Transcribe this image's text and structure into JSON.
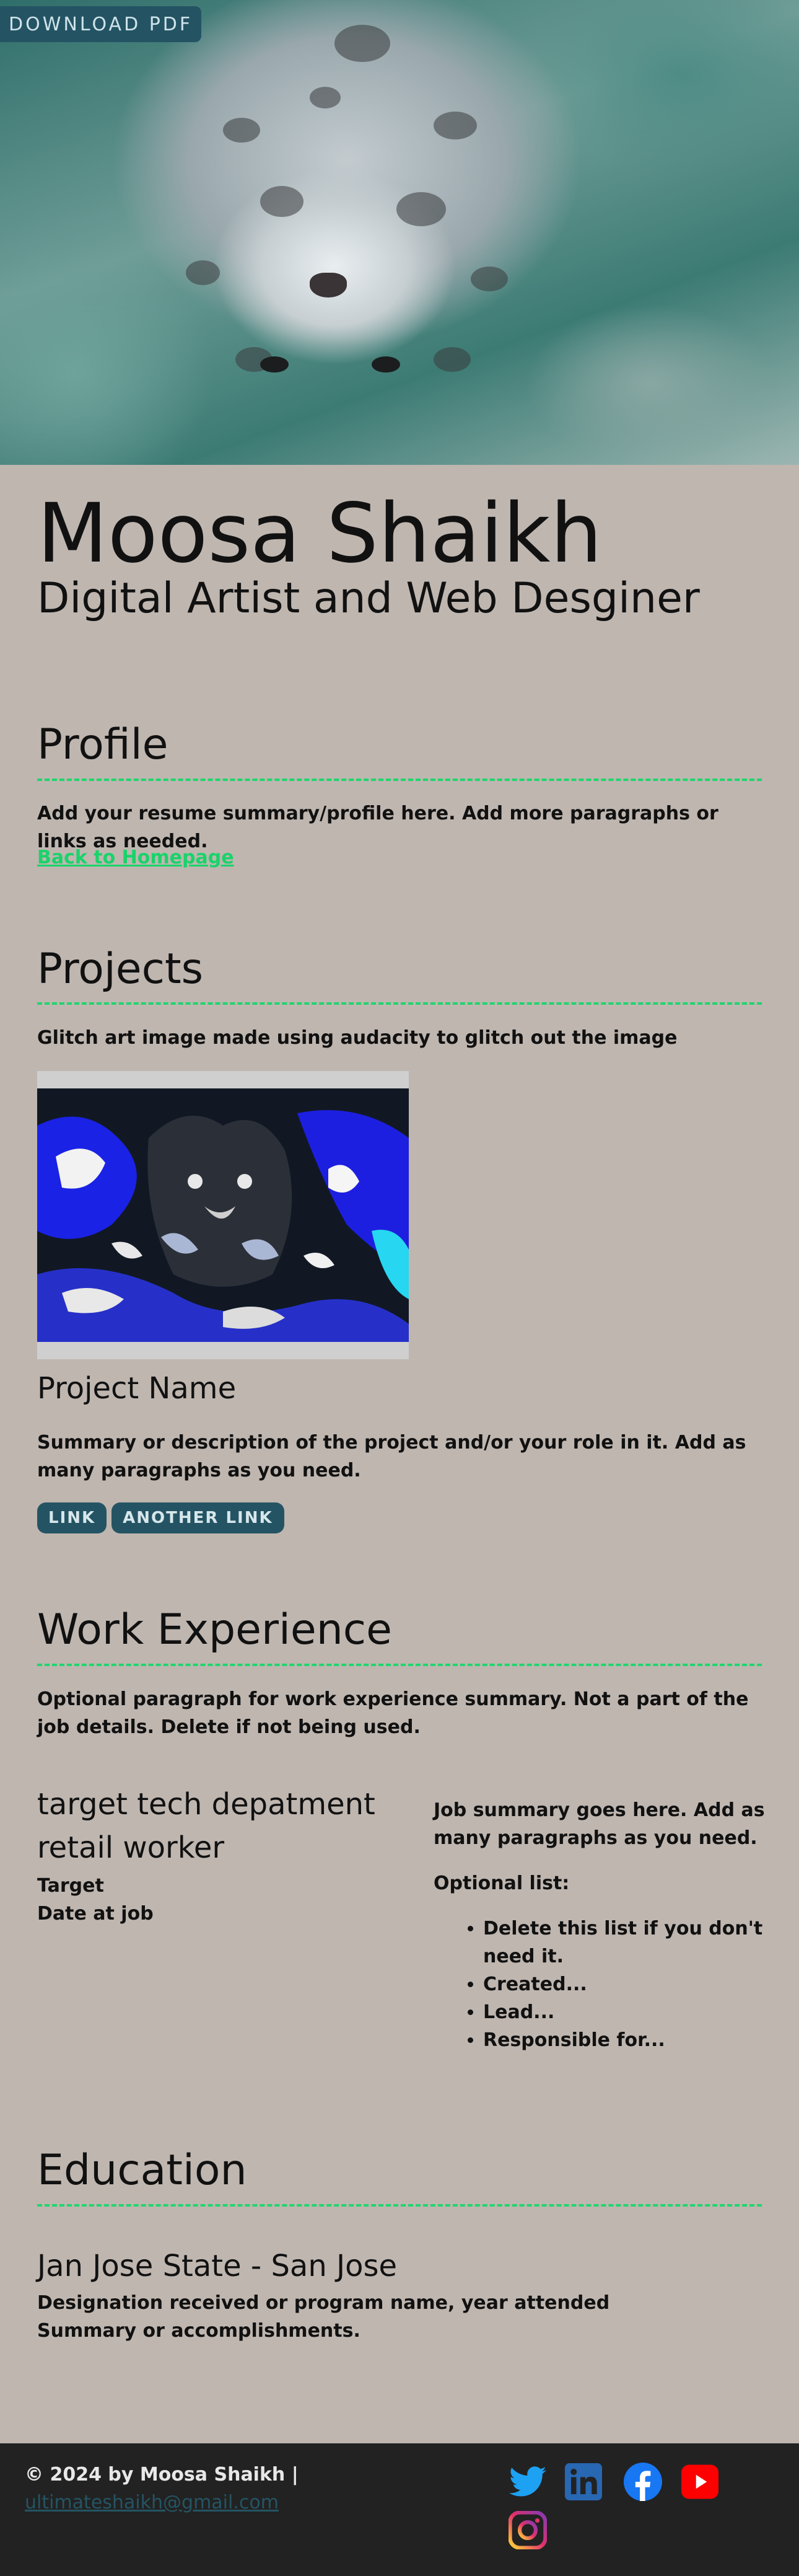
{
  "hero": {
    "download_label": "DOWNLOAD PDF"
  },
  "header": {
    "name": "Moosa Shaikh",
    "subtitle": "Digital Artist and Web Desginer"
  },
  "profile": {
    "heading": "Profile",
    "summary": "Add your resume summary/profile here. Add more paragraphs or links as needed.",
    "back_link": "Back to Homepage"
  },
  "projects": {
    "heading": "Projects",
    "intro": "Glitch art image made using audacity to glitch out the image",
    "project_name": "Project Name",
    "summary": "Summary or description of the project and/or your role in it. Add as many paragraphs as you need.",
    "links": [
      "LINK",
      "ANOTHER LINK"
    ]
  },
  "work": {
    "heading": "Work Experience",
    "intro": "Optional paragraph for work experience summary. Not a part of the job details. Delete if not being used.",
    "job_title_1": "target tech depatment",
    "job_title_2": "retail worker",
    "company": "Target",
    "date": "Date at job",
    "job_summary": "Job summary goes here. Add as many paragraphs as you need.",
    "optional_list_label": "Optional list:",
    "list_items": [
      "Delete this list if you don't need it.",
      "Created...",
      "Lead...",
      "Responsible for..."
    ]
  },
  "education": {
    "heading": "Education",
    "school": "Jan Jose State - San Jose",
    "designation": "Designation received or program name, year attended",
    "summary": "Summary or accomplishments."
  },
  "footer": {
    "copyright": "© 2024 by Moosa Shaikh |",
    "email": "ultimateshaikh@gmail.com",
    "social": [
      "twitter-icon",
      "linkedin-icon",
      "facebook-icon",
      "youtube-icon",
      "instagram-icon"
    ]
  },
  "colors": {
    "background": "#bfb6b0",
    "accent_rule": "#1fd66d",
    "button": "#245463",
    "footer": "#222222"
  }
}
